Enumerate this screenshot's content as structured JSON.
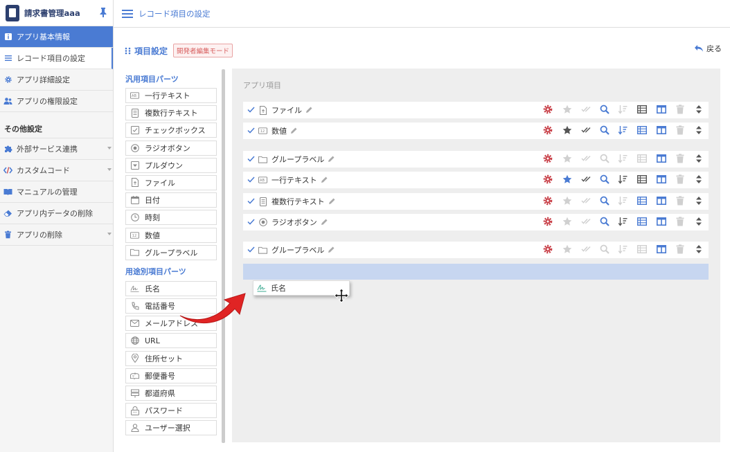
{
  "sidebar": {
    "app_name": "請求書管理aaa",
    "items": [
      {
        "label": "アプリ基本情報",
        "icon": "info-icon",
        "state": "active"
      },
      {
        "label": "レコード項目の設定",
        "icon": "list-icon",
        "state": "current"
      },
      {
        "label": "アプリ詳細設定",
        "icon": "gear-icon",
        "state": ""
      },
      {
        "label": "アプリの権限設定",
        "icon": "users-icon",
        "state": ""
      }
    ],
    "section_title": "その他設定",
    "other_items": [
      {
        "label": "外部サービス連携",
        "icon": "puzzle-icon",
        "caret": true
      },
      {
        "label": "カスタムコード",
        "icon": "code-icon",
        "caret": true
      },
      {
        "label": "マニュアルの管理",
        "icon": "book-icon",
        "caret": false
      },
      {
        "label": "アプリ内データの削除",
        "icon": "eraser-icon",
        "caret": false
      },
      {
        "label": "アプリの削除",
        "icon": "trash-icon",
        "caret": true
      }
    ]
  },
  "header": {
    "title": "レコード項目の設定"
  },
  "section": {
    "title": "項目設定",
    "badge": "開発者編集モード",
    "back_label": "戻る"
  },
  "palette": {
    "general_title": "汎用項目パーツ",
    "general_parts": [
      {
        "label": "一行テキスト",
        "icon": "text-line-icon"
      },
      {
        "label": "複数行テキスト",
        "icon": "multiline-icon"
      },
      {
        "label": "チェックボックス",
        "icon": "checkbox-icon"
      },
      {
        "label": "ラジオボタン",
        "icon": "radio-icon"
      },
      {
        "label": "プルダウン",
        "icon": "dropdown-icon"
      },
      {
        "label": "ファイル",
        "icon": "file-icon"
      },
      {
        "label": "日付",
        "icon": "calendar-icon"
      },
      {
        "label": "時刻",
        "icon": "clock-icon"
      },
      {
        "label": "数値",
        "icon": "number-icon"
      },
      {
        "label": "グループラベル",
        "icon": "folder-icon"
      }
    ],
    "special_title": "用途別項目パーツ",
    "special_parts": [
      {
        "label": "氏名",
        "icon": "signature-icon"
      },
      {
        "label": "電話番号",
        "icon": "phone-icon"
      },
      {
        "label": "メールアドレス",
        "icon": "mail-icon"
      },
      {
        "label": "URL",
        "icon": "globe-icon"
      },
      {
        "label": "住所セット",
        "icon": "location-icon"
      },
      {
        "label": "郵便番号",
        "icon": "postbox-icon"
      },
      {
        "label": "都道府県",
        "icon": "signpost-icon"
      },
      {
        "label": "パスワード",
        "icon": "lock-icon"
      },
      {
        "label": "ユーザー選択",
        "icon": "user-icon"
      }
    ]
  },
  "items_area": {
    "title": "アプリ項目",
    "rows": [
      {
        "label": "ファイル",
        "icon": "file-icon",
        "star": "off",
        "check": "off",
        "search": "on",
        "sort": "off",
        "table": "dark",
        "column": "on",
        "trash": "off"
      },
      {
        "label": "数値",
        "icon": "number-icon",
        "star": "dark",
        "check": "dark",
        "search": "on",
        "sort": "on",
        "table": "on",
        "column": "on",
        "trash": "off"
      },
      {
        "label": "グループラベル",
        "icon": "folder-icon",
        "star": "off",
        "check": "off",
        "search": "off",
        "sort": "off",
        "table": "off",
        "column": "on",
        "trash": "off"
      },
      {
        "label": "一行テキスト",
        "icon": "text-line-icon",
        "star": "on",
        "check": "dark",
        "search": "on",
        "sort": "dark",
        "table": "dark",
        "column": "on",
        "trash": "off"
      },
      {
        "label": "複数行テキスト",
        "icon": "multiline-icon",
        "star": "off",
        "check": "off",
        "search": "on",
        "sort": "off",
        "table": "on",
        "column": "on",
        "trash": "off"
      },
      {
        "label": "ラジオボタン",
        "icon": "radio-icon",
        "star": "off",
        "check": "off",
        "search": "on",
        "sort": "dark",
        "table": "on",
        "column": "on",
        "trash": "off"
      },
      {
        "label": "グループラベル",
        "icon": "folder-icon",
        "star": "off",
        "check": "off",
        "search": "off",
        "sort": "off",
        "table": "off",
        "column": "on",
        "trash": "off"
      }
    ],
    "dragging_label": "氏名"
  },
  "colors": {
    "accent": "#4a7bd3",
    "gear": "#c9424a",
    "dark": "#555555",
    "faded": "#d0d0d0"
  }
}
